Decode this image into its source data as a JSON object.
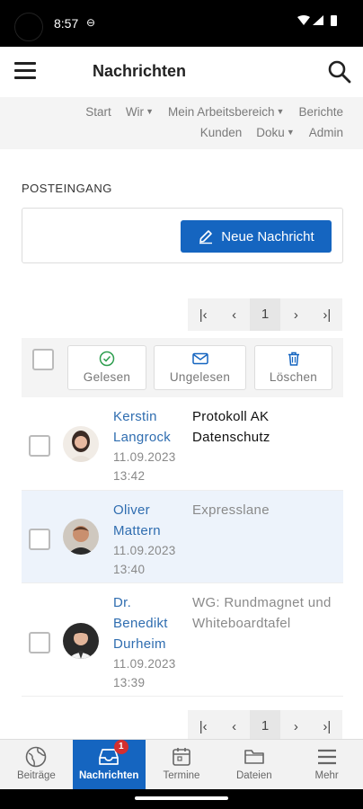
{
  "status_bar": {
    "time": "8:57"
  },
  "app_bar": {
    "title": "Nachrichten"
  },
  "top_nav": {
    "row1": [
      {
        "label": "Start",
        "dropdown": false
      },
      {
        "label": "Wir",
        "dropdown": true
      },
      {
        "label": "Mein Arbeitsbereich",
        "dropdown": true
      },
      {
        "label": "Berichte",
        "dropdown": false
      }
    ],
    "row2": [
      {
        "label": "Kunden",
        "dropdown": false
      },
      {
        "label": "Doku",
        "dropdown": true
      },
      {
        "label": "Admin",
        "dropdown": false
      }
    ]
  },
  "inbox": {
    "section_title": "POSTEINGANG",
    "new_message_label": "Neue Nachricht",
    "pager": {
      "current_page": "1"
    },
    "toolbar": {
      "read_label": "Gelesen",
      "unread_label": "Ungelesen",
      "delete_label": "Löschen"
    },
    "messages": [
      {
        "sender_line1": "Kerstin",
        "sender_line2": "Langrock",
        "date": "11.09.2023",
        "time": "13:42",
        "subject": "Protokoll AK Datenschutz",
        "unread": true
      },
      {
        "sender_line1": "Oliver",
        "sender_line2": "Mattern",
        "date": "11.09.2023",
        "time": "13:40",
        "subject": "Expresslane",
        "unread": false
      },
      {
        "sender_line1": "Dr.",
        "sender_line2": "Benedikt",
        "sender_line3": "Durheim",
        "date": "11.09.2023",
        "time": "13:39",
        "subject": "WG: Rundmagnet und Whiteboardtafel",
        "unread": false
      }
    ]
  },
  "bottom_nav": {
    "items": [
      {
        "label": "Beiträge",
        "icon": "globe-icon"
      },
      {
        "label": "Nachrichten",
        "icon": "inbox-icon",
        "badge": "1"
      },
      {
        "label": "Termine",
        "icon": "calendar-icon"
      },
      {
        "label": "Dateien",
        "icon": "folder-icon"
      },
      {
        "label": "Mehr",
        "icon": "menu-icon"
      }
    ]
  },
  "colors": {
    "accent": "#1565c0",
    "link": "#2f6db0",
    "badge": "#d32f2f",
    "selected_row": "#edf3fb"
  }
}
